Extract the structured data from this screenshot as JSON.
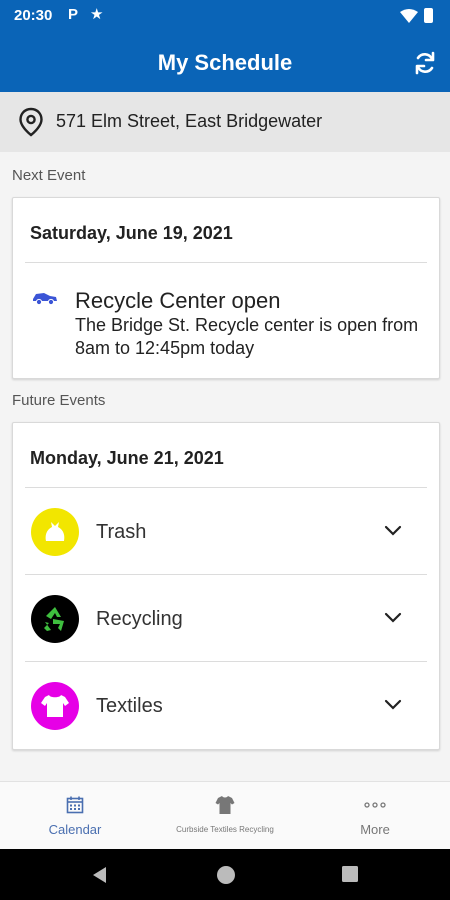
{
  "status_bar": {
    "time": "20:30",
    "p_icon": "P"
  },
  "app_bar": {
    "title": "My Schedule"
  },
  "address": {
    "text": "571 Elm Street, East Bridgewater"
  },
  "next_event": {
    "section_label": "Next Event",
    "date": "Saturday, June 19, 2021",
    "title": "Recycle Center open",
    "description": "The Bridge St. Recycle center is open from 8am to 12:45pm today",
    "icon": "car-icon",
    "icon_color": "#3b55d6"
  },
  "future_events": {
    "section_label": "Future Events",
    "date": "Monday, June 21, 2021",
    "items": [
      {
        "label": "Trash",
        "icon": "trash-bag-icon",
        "color": "#f2e600"
      },
      {
        "label": "Recycling",
        "icon": "recycling-icon",
        "color": "#000000"
      },
      {
        "label": "Textiles",
        "icon": "shirt-icon",
        "color": "#e600e6"
      }
    ]
  },
  "bottom_nav": [
    {
      "label": "Calendar",
      "icon": "calendar-icon",
      "active": true
    },
    {
      "label": "Curbside Textiles Recycling",
      "icon": "shirt-icon",
      "active": false
    },
    {
      "label": "More",
      "icon": "more-icon",
      "active": false
    }
  ],
  "colors": {
    "primary": "#0a64b7",
    "nav_active": "#4a6fb0"
  }
}
